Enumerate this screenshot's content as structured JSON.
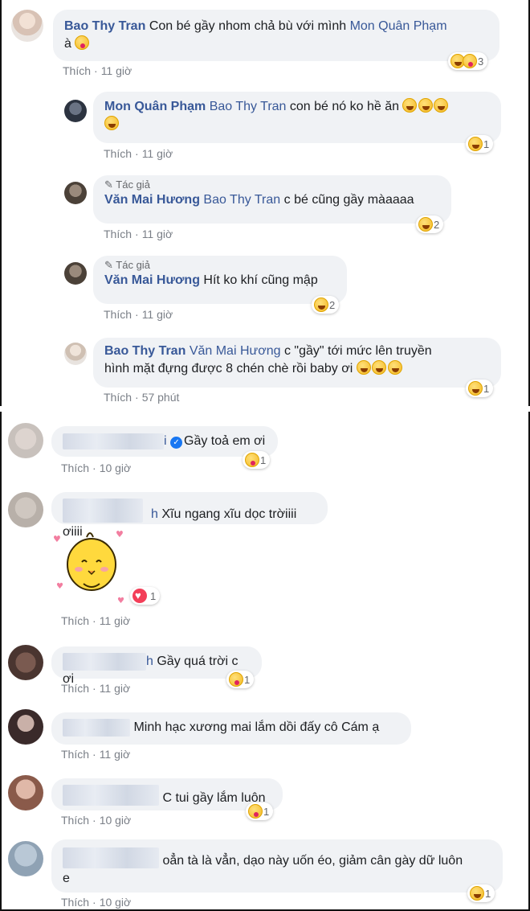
{
  "colors": {
    "name": "#385898",
    "bubble": "#f0f2f5",
    "meta": "#7a7f87"
  },
  "top": {
    "c1": {
      "name": "Bao Thy Tran",
      "text": "Con bé gầy nhom chả bù với mình",
      "mention": "Mon Quân Phạm",
      "text2": "à",
      "like": "Thích",
      "time": "11 giờ",
      "react_count": "3"
    },
    "c2": {
      "name": "Mon Quân Phạm",
      "mention": "Bao Thy Tran",
      "text": "con bé nó ko hề ăn",
      "like": "Thích",
      "time": "11 giờ",
      "react_count": "1"
    },
    "c3": {
      "tag": "Tác giả",
      "name": "Văn Mai Hương",
      "mention": "Bao Thy Tran",
      "text": "c bé cũng gầy màaaaa",
      "like": "Thích",
      "time": "11 giờ",
      "react_count": "2"
    },
    "c4": {
      "tag": "Tác giả",
      "name": "Văn Mai Hương",
      "text": "Hít ko khí cũng mập",
      "like": "Thích",
      "time": "11 giờ",
      "react_count": "2"
    },
    "c5": {
      "name": "Bao Thy Tran",
      "mention": "Văn Mai Hương",
      "text": "c \"gầy\" tới mức lên truyền",
      "text2": "hình mặt đựng được 8 chén chè rồi baby ơi",
      "like": "Thích",
      "time": "57 phút",
      "react_count": "1"
    }
  },
  "bottom": {
    "d1": {
      "name_tail": "i",
      "text": "Gầy toả em ơi",
      "like": "Thích",
      "time": "10 giờ",
      "react_count": "1"
    },
    "d2": {
      "name_tail": "h",
      "text": "Xĩu ngang xĩu dọc trờiiii ơiiii",
      "like": "Thích",
      "time": "11 giờ",
      "react_count": "1"
    },
    "d3": {
      "name_tail": "h",
      "text": "Gầy quá trời c ơi",
      "like": "Thích",
      "time": "11 giờ",
      "react_count": "1"
    },
    "d4": {
      "text": "Minh hạc xương mai lắm dồi đấy cô Cám ạ",
      "like": "Thích",
      "time": "11 giờ"
    },
    "d5": {
      "text": "C tui gầy lắm luôn",
      "like": "Thích",
      "time": "10 giờ",
      "react_count": "1"
    },
    "d6": {
      "text": "oẳn tà là vẳn, dạo này uốn éo, giảm cân gày dữ luôn",
      "text2": "e",
      "like": "Thích",
      "time": "10 giờ",
      "react_count": "1"
    }
  },
  "icons": [
    "haha-reaction-icon",
    "care-reaction-icon",
    "love-reaction-icon",
    "verified-badge-icon",
    "pencil-icon"
  ]
}
